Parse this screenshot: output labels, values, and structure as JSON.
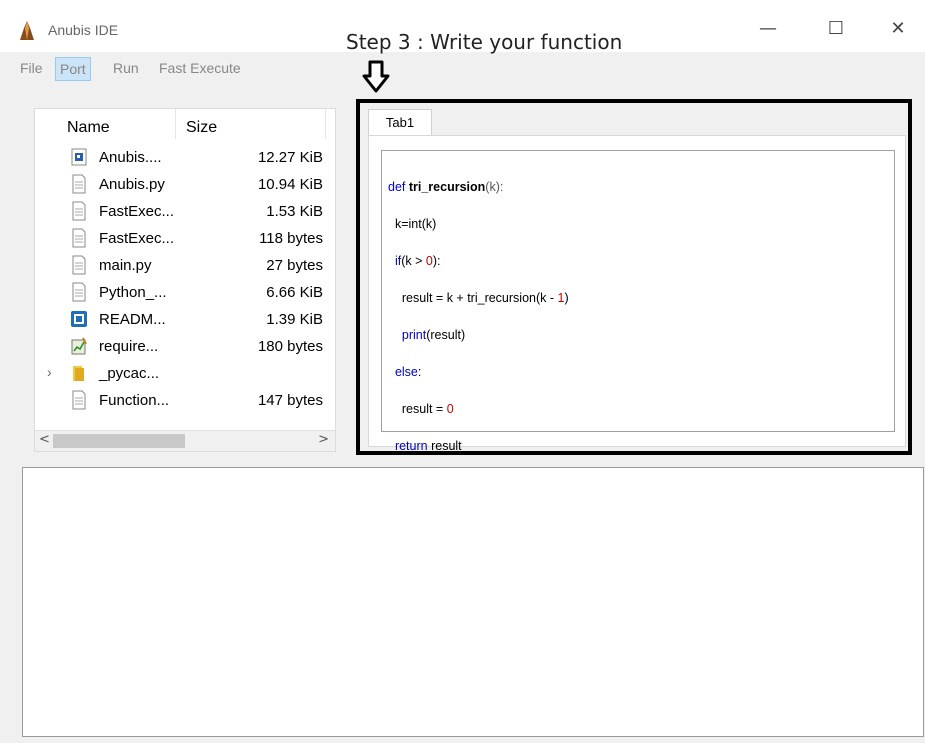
{
  "window": {
    "title": "Anubis IDE",
    "minimize_glyph": "—",
    "maximize_glyph": "☐",
    "close_glyph": "✕"
  },
  "annotation": {
    "step_label": "Step 3 : Write your function"
  },
  "menu": {
    "items": [
      "File",
      "Port",
      "Run",
      "Fast Execute"
    ]
  },
  "file_browser": {
    "col_name": "Name",
    "col_size": "Size",
    "files": [
      {
        "name": "Anubis....",
        "size": "12.27 KiB",
        "icon": "image-file-icon"
      },
      {
        "name": "Anubis.py",
        "size": "10.94 KiB",
        "icon": "document-icon"
      },
      {
        "name": "FastExec...",
        "size": "1.53 KiB",
        "icon": "document-icon"
      },
      {
        "name": "FastExec...",
        "size": "118 bytes",
        "icon": "document-icon"
      },
      {
        "name": "main.py",
        "size": "27 bytes",
        "icon": "document-icon"
      },
      {
        "name": "Python_...",
        "size": "6.66 KiB",
        "icon": "document-icon"
      },
      {
        "name": "READM...",
        "size": "1.39 KiB",
        "icon": "markdown-icon"
      },
      {
        "name": "require...",
        "size": "180 bytes",
        "icon": "text-chart-icon"
      },
      {
        "name": "_pycac...",
        "size": "",
        "icon": "folder-icon"
      },
      {
        "name": "Function...",
        "size": "147 bytes",
        "icon": "document-icon"
      }
    ]
  },
  "editor": {
    "tab_label": "Tab1",
    "code": {
      "l1_kw": "def ",
      "l1_fn": "tri_recursion",
      "l1_rest": "(k):",
      "l2": "  k=int(k)",
      "l3_kw": "  if",
      "l3_a": "(k > ",
      "l3_num": "0",
      "l3_b": "):",
      "l4_a": "    result = k + tri_recursion(k - ",
      "l4_num": "1",
      "l4_b": ")",
      "l5_kw": "    print",
      "l5_b": "(result)",
      "l6_kw": "  else",
      "l6_b": ":",
      "l7_a": "    result = ",
      "l7_num": "0",
      "l8_kw": "  return",
      "l8_b": " result"
    }
  },
  "colors": {
    "keyword": "#0000cc",
    "number": "#cc0000",
    "menu_highlight": "#cce4f7",
    "frame_border": "#000000"
  }
}
